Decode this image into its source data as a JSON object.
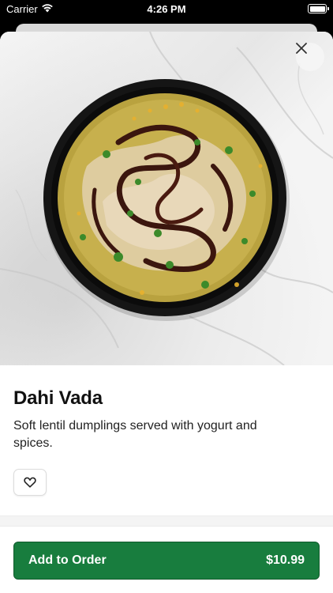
{
  "status_bar": {
    "carrier": "Carrier",
    "time": "4:26 PM",
    "wifi_icon": "wifi-icon",
    "battery_icon": "battery-icon"
  },
  "item": {
    "name": "Dahi Vada",
    "description": "Soft lentil dumplings served with yogurt and spices."
  },
  "actions": {
    "close_icon": "close-icon",
    "favorite_icon": "heart-outline-icon",
    "add_label": "Add to Order",
    "price": "$10.99"
  },
  "colors": {
    "accent": "#187d3e",
    "text": "#111111"
  }
}
